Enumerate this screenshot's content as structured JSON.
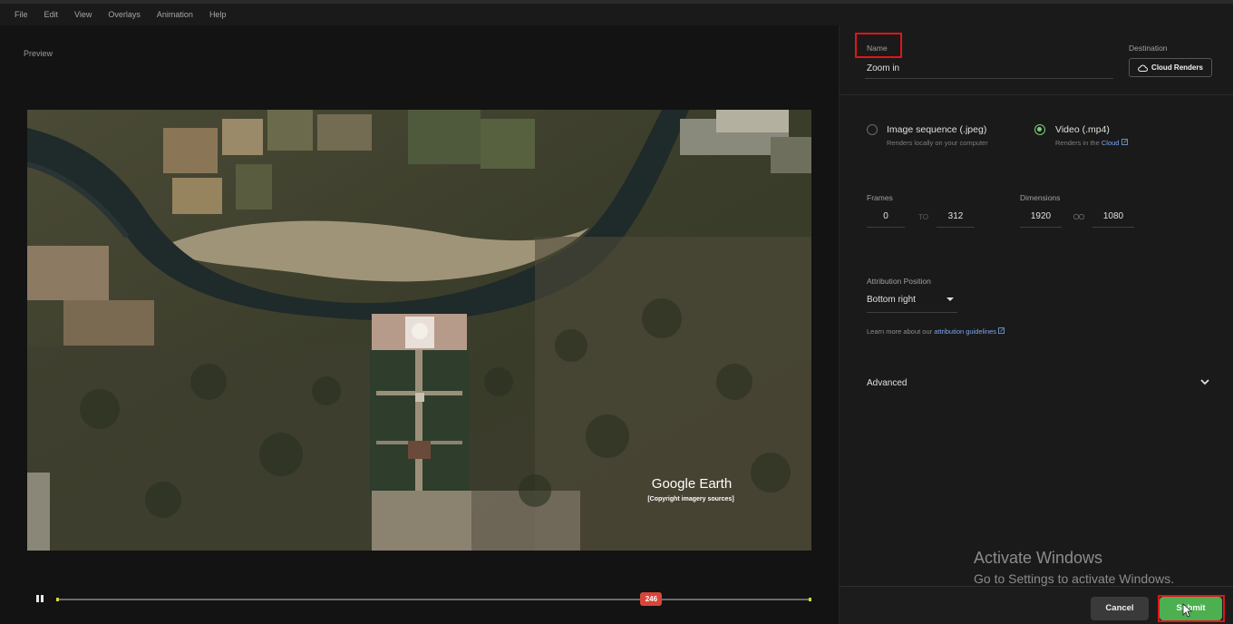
{
  "menu": [
    "File",
    "Edit",
    "View",
    "Overlays",
    "Animation",
    "Help"
  ],
  "preview": {
    "label": "Preview",
    "logo_text": "Google Earth",
    "copyright": "[Copyright imagery sources]"
  },
  "timeline": {
    "current_frame": "246",
    "progress": 0.788
  },
  "panel": {
    "name_label": "Name",
    "name_value": "Zoom in",
    "destination_label": "Destination",
    "destination_button": "Cloud Renders",
    "options": [
      {
        "title": "Image sequence (.jpeg)",
        "subtitle": "Renders locally on your computer",
        "selected": false
      },
      {
        "title": "Video (.mp4)",
        "subtitle": "Renders in the",
        "link": "Cloud",
        "selected": true
      }
    ],
    "frames_label": "Frames",
    "frames_from": "0",
    "frames_to_sep": "TO",
    "frames_to": "312",
    "dimensions_label": "Dimensions",
    "width": "1920",
    "height": "1080",
    "attribution_label": "Attribution Position",
    "attribution_value": "Bottom right",
    "learn_text": "Learn more about our",
    "learn_link": "attribution guidelines",
    "advanced_label": "Advanced",
    "cancel_label": "Cancel",
    "submit_label": "Submit"
  },
  "watermark": {
    "line1": "Activate Windows",
    "line2": "Go to Settings to activate Windows."
  },
  "colors": {
    "accent_green": "#4caf50",
    "highlight_red": "#e0151a",
    "playhead_red": "#d9453a",
    "link_blue": "#7aa6f0"
  }
}
